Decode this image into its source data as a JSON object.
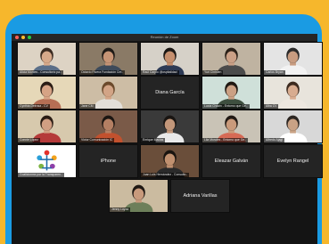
{
  "window": {
    "title": "Reunión de Zoom",
    "dot_colors": [
      "#ff5f57",
      "#febc2e",
      "#28c840"
    ]
  },
  "participants": [
    {
      "name": "Alicia Montes - Consultorio pa..",
      "kind": "video",
      "bg": "#ddd3c4",
      "skin": "#d7a98a",
      "hair": "#3a2a20",
      "shirt": "#5a6e88"
    },
    {
      "name": "Octavio Rivera Fundación Cre..",
      "kind": "video",
      "bg": "#8a7a66",
      "skin": "#c69475",
      "hair": "#1e1a16",
      "shirt": "#3d4a5a"
    },
    {
      "name": "Raúl Carpio @ospitalidad",
      "kind": "video",
      "bg": "#d6d1c8",
      "skin": "#c58f6e",
      "hair": "#1b1714",
      "shirt": "#2d3a55"
    },
    {
      "name": "Yuri Christen",
      "kind": "video",
      "bg": "#bfb3a1",
      "skin": "#caa086",
      "hair": "#2a2018",
      "shirt": "#4b4b4b"
    },
    {
      "name": "Carlos Bryan",
      "kind": "video",
      "bg": "#e4e4e4",
      "skin": "#c89c80",
      "hair": "#2a2a2a",
      "shirt": "#f2f2f2"
    },
    {
      "name": "Cynthia Delrosa - CV",
      "kind": "video",
      "bg": "#e6d8b8",
      "skin": "#d6a385",
      "hair": "#2b1d15",
      "shirt": "#b66e54"
    },
    {
      "name": "Jane CM",
      "kind": "video",
      "bg": "#cdbda5",
      "skin": "#d2a486",
      "hair": "#6b4a2c",
      "shirt": "#e3dfd9"
    },
    {
      "name": "Diana García",
      "kind": "label"
    },
    {
      "name": "Lucía Cházin - Entorno que Ge..",
      "kind": "video",
      "bg": "#cfe0d9",
      "skin": "#cba084",
      "hair": "#201812",
      "shirt": "#3e4f3f"
    },
    {
      "name": "Alba CV",
      "kind": "video",
      "bg": "#e8e4dc",
      "skin": "#d8ac90",
      "hair": "#3c2a1f",
      "shirt": "#ede7df"
    },
    {
      "name": "Connie López",
      "kind": "video",
      "bg": "#d7c9ad",
      "skin": "#d19f83",
      "hair": "#2a1c14",
      "shirt": "#b53a3a"
    },
    {
      "name": "Victor Comunicación IC",
      "kind": "video",
      "bg": "#7a5a48",
      "skin": "#b47f63",
      "hair": "#1c1612",
      "shirt": "#c2512e"
    },
    {
      "name": "Enrique Macias",
      "kind": "video",
      "bg": "#3a3a3a",
      "skin": "#c3977a",
      "hair": "#191512",
      "shirt": "#e9e9e9"
    },
    {
      "name": "Lila Morales - Entorno que Ge..",
      "kind": "video",
      "bg": "#c9c3b6",
      "skin": "#c99a7b",
      "hair": "#221a15",
      "shirt": "#d66a55"
    },
    {
      "name": "Alfredo Ajagi",
      "kind": "video",
      "bg": "#d8d8d8",
      "skin": "#c9a285",
      "hair": "#2c2622",
      "shirt": "#ffffff"
    },
    {
      "name": "Coalicionmx por la Transparen..",
      "kind": "logo",
      "bg": "#ffffff"
    },
    {
      "name": "iPhone",
      "kind": "label"
    },
    {
      "name": "Juan Luis Hernández - Consulto..",
      "kind": "video",
      "bg": "#6a4e3a",
      "skin": "#c0906f",
      "hair": "#19140f",
      "shirt": "#2a2a2a"
    },
    {
      "name": "Eleazar Galván",
      "kind": "label"
    },
    {
      "name": "Evelyn Rangel",
      "kind": "label"
    },
    {
      "name": "Jenny Loyza",
      "kind": "video",
      "bg": "#cbbba0",
      "skin": "#c89a7c",
      "hair": "#1f1813",
      "shirt": "#6d7f5a"
    },
    {
      "name": "Adriana Varillas",
      "kind": "label"
    }
  ]
}
